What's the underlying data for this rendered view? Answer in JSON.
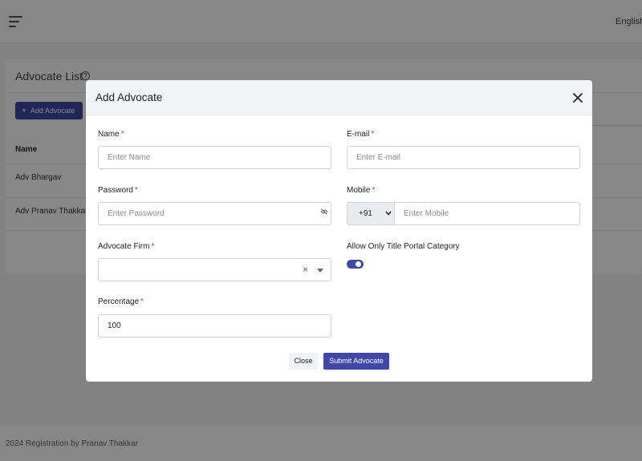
{
  "header": {
    "language": "English"
  },
  "advocate_list": {
    "title": "Advocate List",
    "add_button": "Add Advocate",
    "columns": [
      "Name"
    ],
    "rows": [
      "Adv Bhargav",
      "Adv Pranav Thakkar"
    ]
  },
  "footer": {
    "text": "2024 Registration by Pranav Thakkar"
  },
  "modal": {
    "title": "Add Advocate",
    "fields": {
      "name": {
        "label": "Name",
        "placeholder": "Enter Name"
      },
      "email": {
        "label": "E-mail",
        "placeholder": "Enter E-mail"
      },
      "password": {
        "label": "Password",
        "placeholder": "Enter Password"
      },
      "mobile": {
        "label": "Mobile",
        "country_code": "+91",
        "placeholder": "Enter Mobile"
      },
      "firm": {
        "label": "Advocate Firm",
        "value": ""
      },
      "title_portal": {
        "label": "Allow Only Title Portal Category",
        "enabled": true
      },
      "percentage": {
        "label": "Percentage",
        "value": "100"
      }
    },
    "buttons": {
      "close": "Close",
      "submit": "Submit Advocate"
    },
    "required_marker": "*"
  },
  "colors": {
    "primary": "#3f48a8",
    "required": "#d9363e"
  }
}
